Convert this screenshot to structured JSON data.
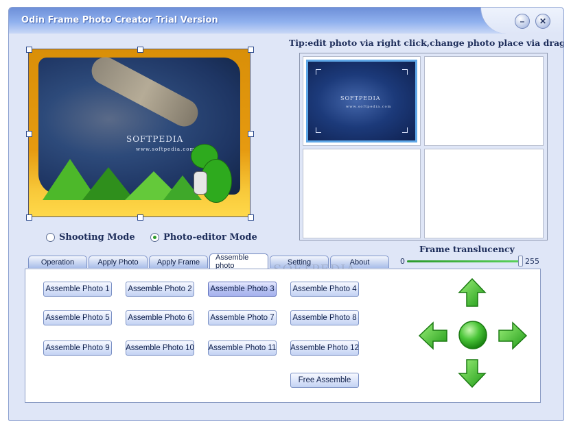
{
  "window": {
    "title": "Odin Frame Photo Creator Trial Version",
    "minimize_glyph": "–",
    "close_glyph": "✕"
  },
  "preview": {
    "watermark": "SOFTPEDIA",
    "watermark_url": "www.softpedia.com"
  },
  "mode": {
    "options": [
      {
        "label": "Shooting Mode",
        "selected": false
      },
      {
        "label": "Photo-editor Mode",
        "selected": true
      }
    ]
  },
  "tip": "Tip:edit photo via right click,change photo place via drag it",
  "thumbnails": {
    "cells": [
      {
        "has_photo": true,
        "watermark": "SOFTPEDIA",
        "watermark_url": "www.softpedia.com"
      },
      {
        "has_photo": false
      },
      {
        "has_photo": false
      },
      {
        "has_photo": false
      }
    ]
  },
  "translucency": {
    "label": "Frame translucency",
    "min": "0",
    "max": "255",
    "value": 255
  },
  "tabs": [
    {
      "label": "Operation",
      "active": false
    },
    {
      "label": "Apply Photo",
      "active": false
    },
    {
      "label": "Apply Frame",
      "active": false
    },
    {
      "label": "Assemble photo",
      "active": true
    },
    {
      "label": "Setting",
      "active": false
    },
    {
      "label": "About",
      "active": false
    }
  ],
  "assemble_buttons": [
    "Assemble Photo 1",
    "Assemble Photo 2",
    "Assemble Photo 3",
    "Assemble Photo 4",
    "Assemble Photo 5",
    "Assemble Photo 6",
    "Assemble Photo 7",
    "Assemble Photo 8",
    "Assemble Photo 9",
    "Assemble Photo 10",
    "Assemble Photo 11",
    "Assemble Photo 12"
  ],
  "selected_assemble": "Assemble Photo 3",
  "free_assemble": "Free Assemble",
  "overlay_watermark": "SOFTPEDIA",
  "colors": {
    "accent_green": "#2eaa1e",
    "window_bg": "#dfe6f7",
    "title_gradient_top": "#6d8fd8"
  }
}
